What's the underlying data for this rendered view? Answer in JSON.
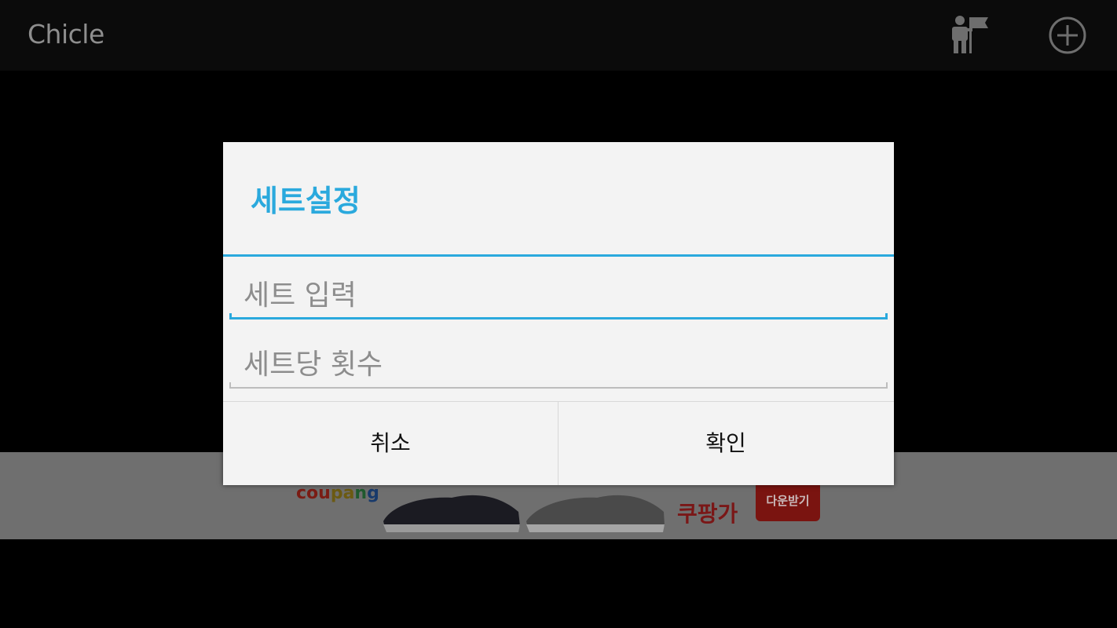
{
  "app": {
    "title": "Chicle",
    "actions": [
      {
        "icon": "person-flag-icon"
      },
      {
        "icon": "add-circle-icon"
      }
    ]
  },
  "ad": {
    "brand": [
      "cou",
      "pa",
      "n",
      "g"
    ],
    "headline": "쿠팡가",
    "button_label": "다운받기",
    "colors": {
      "background": "#6f6f6f",
      "button": "#7a1410"
    }
  },
  "dialog": {
    "title": "세트설정",
    "fields": [
      {
        "placeholder": "세트 입력",
        "value": ""
      },
      {
        "placeholder": "세트당 횟수",
        "value": ""
      }
    ],
    "buttons": {
      "cancel": "취소",
      "ok": "확인"
    },
    "colors": {
      "accent": "#2aa9dd",
      "background": "#f3f3f3"
    }
  }
}
